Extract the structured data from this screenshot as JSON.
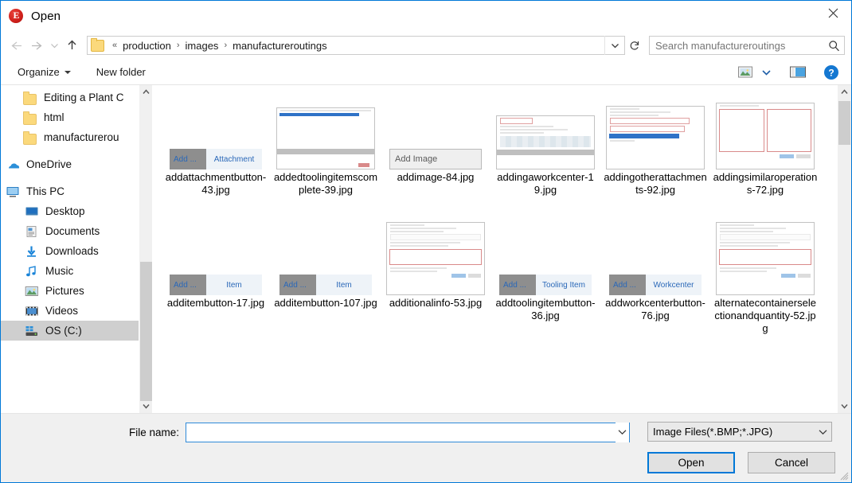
{
  "window": {
    "title": "Open",
    "app_icon": "app-logo-icon",
    "close_label": "✕",
    "accent_color": "#0078d7"
  },
  "navigation": {
    "back_label": "←",
    "forward_label": "→",
    "recent_label": "∨",
    "up_label": "↑",
    "refresh_label": "↻",
    "dropdown_label": "∨"
  },
  "breadcrumb": {
    "overflow": "«",
    "separator": "›",
    "items": [
      "production",
      "images",
      "manufactureroutings"
    ]
  },
  "search": {
    "placeholder": "Search manufactureroutings",
    "value": "",
    "icon": "search-icon"
  },
  "command_bar": {
    "organize_label": "Organize",
    "new_folder_label": "New folder",
    "view_icon": "view-thumbnails-icon",
    "view_caret": "▾",
    "preview_pane_icon": "preview-pane-icon",
    "help_icon": "help-icon",
    "help_label": "?"
  },
  "sidebar": {
    "items": [
      {
        "label": "Editing a Plant C",
        "icon": "folder-icon",
        "indent": 1,
        "selected": false,
        "gap": false
      },
      {
        "label": "html",
        "icon": "folder-icon",
        "indent": 1,
        "selected": false,
        "gap": false
      },
      {
        "label": "manufacturerou",
        "icon": "folder-icon",
        "indent": 1,
        "selected": false,
        "gap": false
      },
      {
        "label": "OneDrive",
        "icon": "onedrive-icon",
        "indent": 0,
        "selected": false,
        "gap": true
      },
      {
        "label": "This PC",
        "icon": "this-pc-icon",
        "indent": 0,
        "selected": false,
        "gap": true
      },
      {
        "label": "Desktop",
        "icon": "desktop-icon",
        "indent": 2,
        "selected": false,
        "gap": false
      },
      {
        "label": "Documents",
        "icon": "documents-icon",
        "indent": 2,
        "selected": false,
        "gap": false
      },
      {
        "label": "Downloads",
        "icon": "downloads-icon",
        "indent": 2,
        "selected": false,
        "gap": false
      },
      {
        "label": "Music",
        "icon": "music-icon",
        "indent": 2,
        "selected": false,
        "gap": false
      },
      {
        "label": "Pictures",
        "icon": "pictures-icon",
        "indent": 2,
        "selected": false,
        "gap": false
      },
      {
        "label": "Videos",
        "icon": "videos-icon",
        "indent": 2,
        "selected": false,
        "gap": false
      },
      {
        "label": "OS (C:)",
        "icon": "drive-icon",
        "indent": 2,
        "selected": true,
        "gap": false
      }
    ]
  },
  "files": {
    "items": [
      {
        "name": "addattachmentbutton-43.jpg",
        "thumb": "button-add-attachment"
      },
      {
        "name": "addedtoolingitemscomplete-39.jpg",
        "thumb": "window-blue-bar"
      },
      {
        "name": "addimage-84.jpg",
        "thumb": "field-add-image"
      },
      {
        "name": "addingaworkcenter-19.jpg",
        "thumb": "window-form-wide"
      },
      {
        "name": "addingotherattachments-92.jpg",
        "thumb": "window-form-blue"
      },
      {
        "name": "addingsimilaroperations-72.jpg",
        "thumb": "window-two-panel"
      },
      {
        "name": "additembutton-17.jpg",
        "thumb": "button-add-item"
      },
      {
        "name": "additembutton-107.jpg",
        "thumb": "button-add-item"
      },
      {
        "name": "additionalinfo-53.jpg",
        "thumb": "window-tall-form"
      },
      {
        "name": "addtoolingitembutton-36.jpg",
        "thumb": "button-add-tooling-item"
      },
      {
        "name": "addworkcenterbutton-76.jpg",
        "thumb": "button-add-workcenter"
      },
      {
        "name": "alternatecontainerselectionandquantity-52.jpg",
        "thumb": "window-tall-form"
      }
    ],
    "thumb_text": {
      "add": "Add",
      "attachment": "Attachment",
      "item": "Item",
      "tooling_item": "Tooling Item",
      "workcenter": "Workcenter",
      "add_image": "Add Image"
    }
  },
  "footer": {
    "filename_label": "File name:",
    "filename_value": "",
    "filename_placeholder": "",
    "filetype_value": "Image Files(*.BMP;*.JPG)",
    "filetype_arrow": "∨",
    "open_label": "Open",
    "cancel_label": "Cancel"
  }
}
